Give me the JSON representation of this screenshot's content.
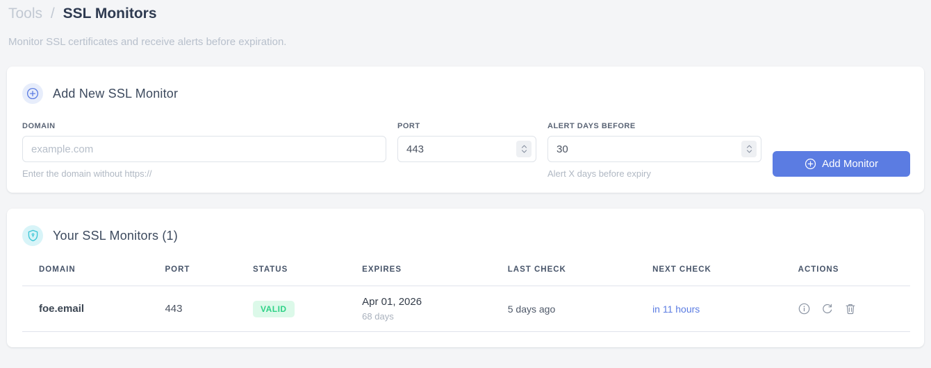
{
  "page": {
    "breadcrumb": {
      "parent": "Tools",
      "separator": "/",
      "current": "SSL Monitors"
    },
    "subtitle": "Monitor SSL certificates and receive alerts before expiration."
  },
  "add_monitor_card": {
    "title": "Add New SSL Monitor",
    "header_icon": "plus-circle-icon",
    "fields": {
      "domain": {
        "label": "DOMAIN",
        "placeholder": "example.com",
        "value": "",
        "helper": "Enter the domain without https://"
      },
      "port": {
        "label": "PORT",
        "value": "443"
      },
      "alert_days": {
        "label": "ALERT DAYS BEFORE",
        "value": "30",
        "helper": "Alert X days before expiry"
      }
    },
    "submit_button": {
      "label": "Add Monitor",
      "icon": "plus-circle-icon"
    }
  },
  "monitors_card": {
    "title": "Your SSL Monitors (1)",
    "header_icon": "shield-lock-icon",
    "table": {
      "headers": [
        "DOMAIN",
        "PORT",
        "STATUS",
        "EXPIRES",
        "LAST CHECK",
        "NEXT CHECK",
        "ACTIONS"
      ],
      "rows": [
        {
          "domain": "foe.email",
          "port": "443",
          "status": "VALID",
          "expires_date": "Apr 01, 2026",
          "expires_days": "68 days",
          "last_check": "5 days ago",
          "next_check": "in 11 hours",
          "actions": [
            "info-icon",
            "refresh-icon",
            "trash-icon"
          ]
        }
      ]
    }
  },
  "colors": {
    "accent_blue": "#5b7ce2",
    "valid_green": "#2fd287",
    "valid_bg": "#dcf9e9",
    "shield_teal": "#3bc5d5",
    "page_bg": "#f4f5f7"
  }
}
